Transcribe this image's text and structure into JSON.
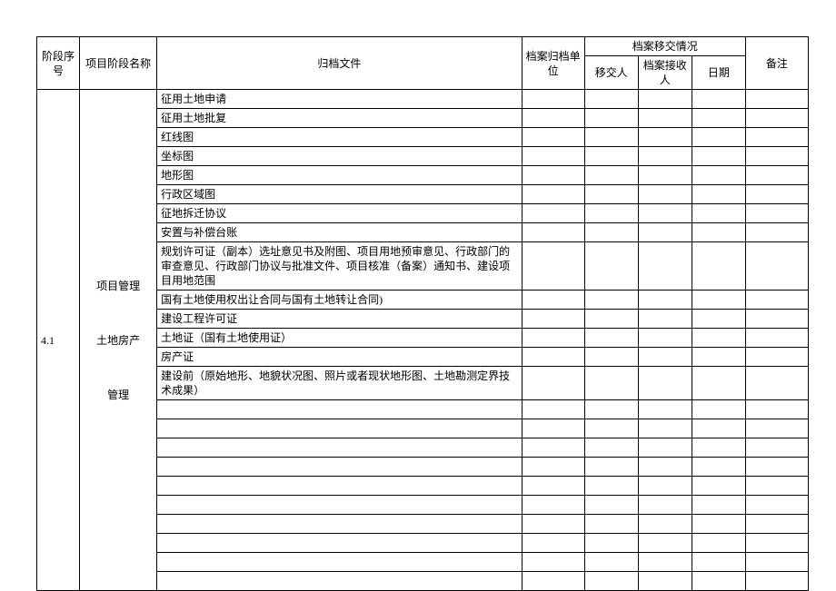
{
  "headers": {
    "seq": "阶段序号",
    "stage": "项目阶段名称",
    "file": "归档文件",
    "unit": "档案归档单位",
    "transfer_group": "档案移交情况",
    "transfer_person": "移交人",
    "receiver": "档案接收人",
    "date": "日期",
    "note": "备注"
  },
  "body": {
    "seq": "4.1",
    "stage_line1": "项目管理",
    "stage_line2": "土地房产",
    "stage_line3": "管理",
    "rows": [
      "征用土地申请",
      "征用土地批复",
      "红线图",
      "坐标图",
      "地形图",
      "行政区域图",
      "征地拆迁协议",
      "安置与补偿台账",
      "规划许可证（副本）选址意见书及附图、项目用地预审意见、行政部门的审查意见、行政部门协议与批准文件、项目核准（备案）通知书、建设项目用地范围",
      "国有土地使用权出让合同与国有土地转让合同)",
      "建设工程许可证",
      "土地证（国有土地使用证）",
      "房产证",
      "建设前（原始地形、地貌状况图、照片或者现状地形图、土地勘测定界技术成果）",
      "",
      "",
      "",
      "",
      "",
      "",
      "",
      "",
      "",
      ""
    ]
  }
}
